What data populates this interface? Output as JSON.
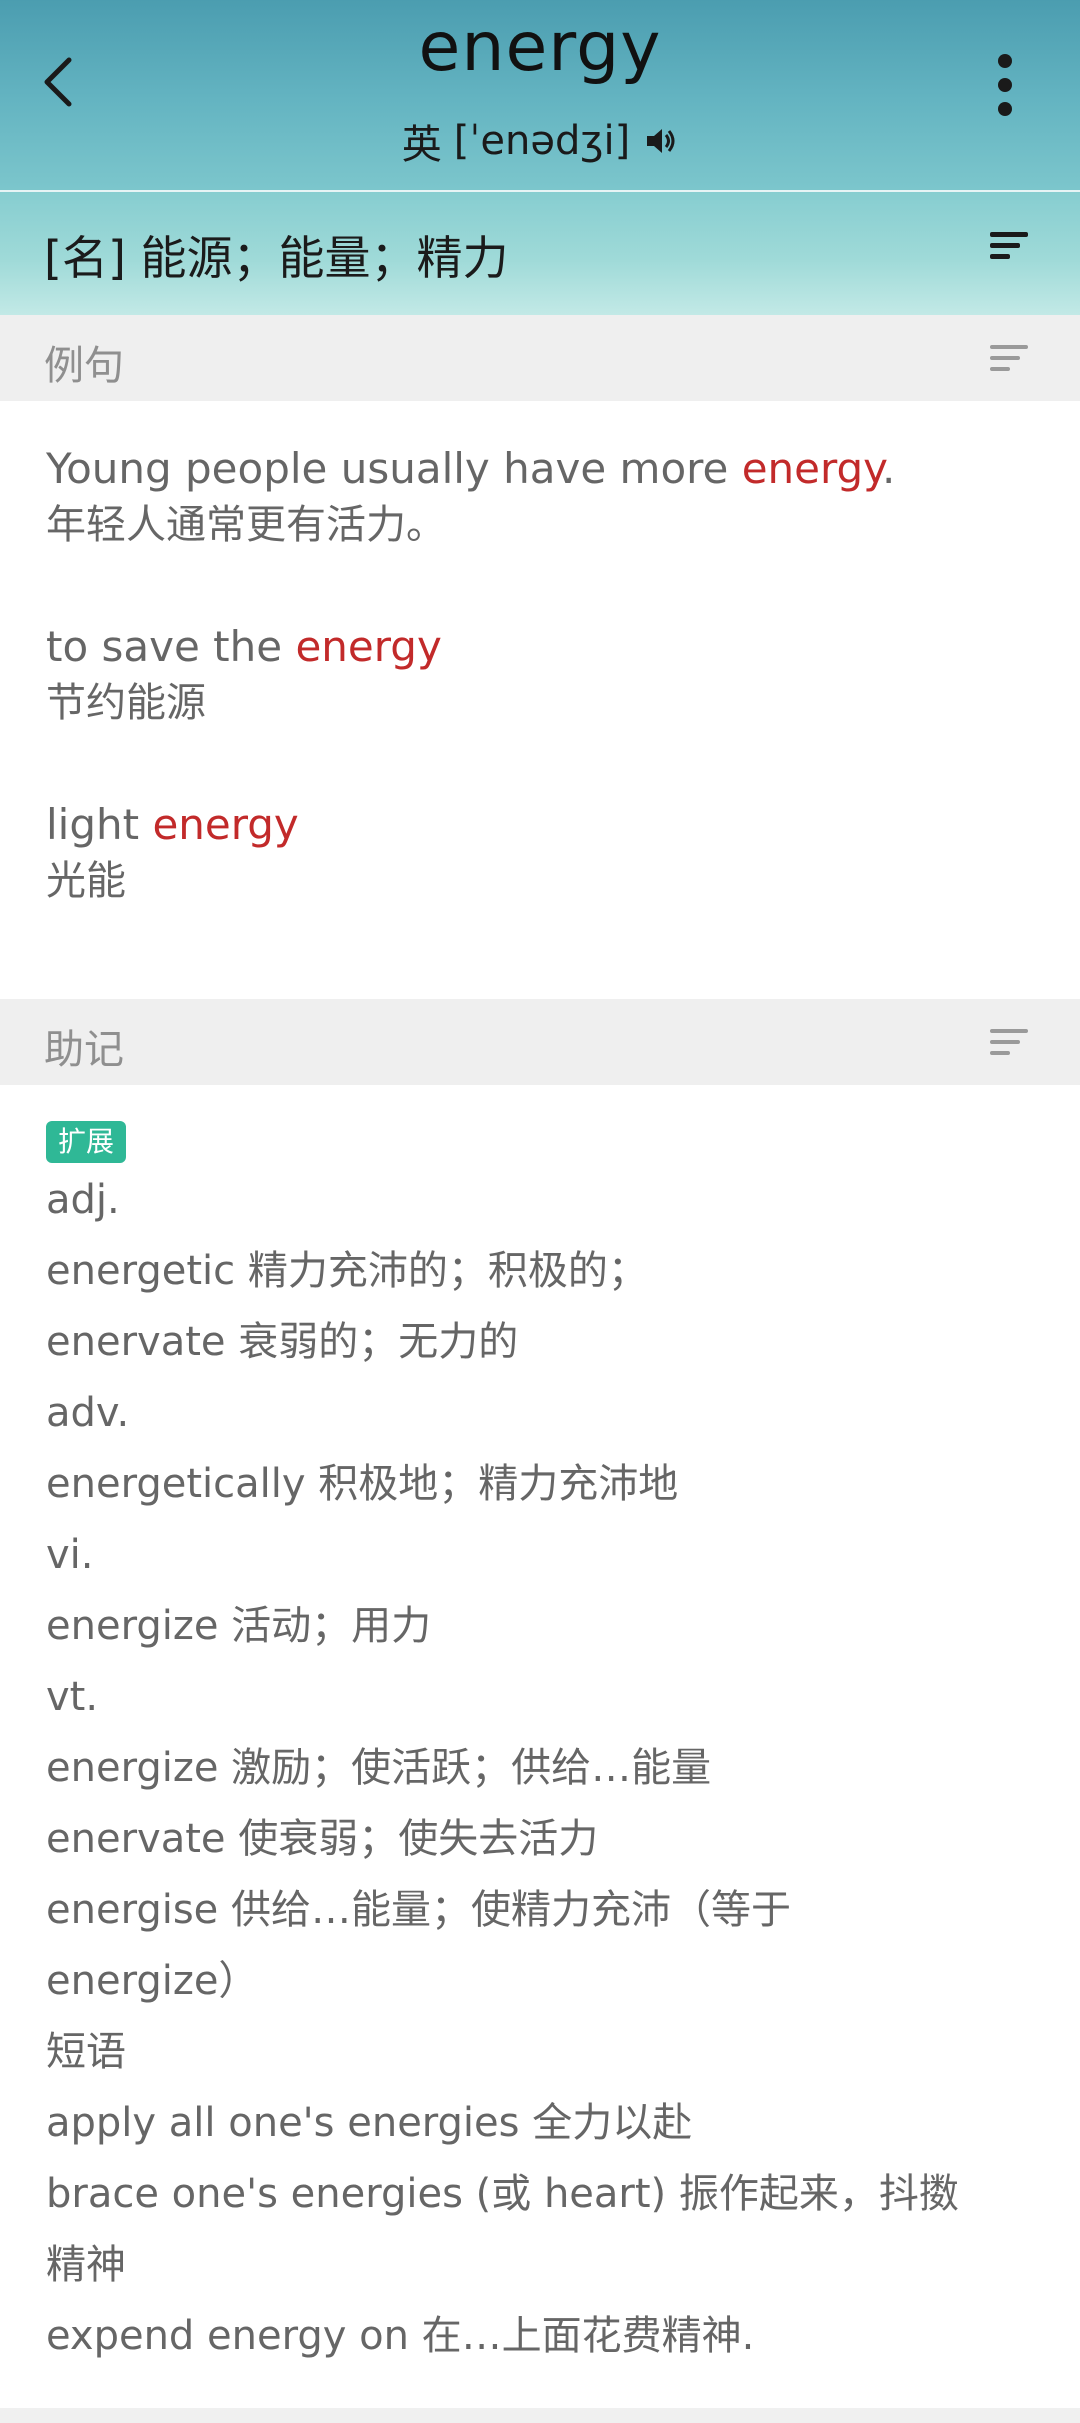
{
  "header": {
    "word": "energy",
    "region": "英",
    "ipa": "[ˈenədʒi]"
  },
  "meaning": "[名] 能源；能量；精力",
  "examples_section": {
    "title": "例句",
    "items": [
      {
        "pre": "Young people usually have more ",
        "hl": "energy",
        "post": ".",
        "zh": "年轻人通常更有活力。"
      },
      {
        "pre": "to save the ",
        "hl": "energy",
        "post": "",
        "zh": "节约能源"
      },
      {
        "pre": "light ",
        "hl": "energy",
        "post": "",
        "zh": "光能"
      }
    ]
  },
  "mnemonic_section": {
    "title": "助记",
    "tag": "扩展",
    "lines": [
      "adj.",
      "energetic 精力充沛的；积极的；",
      "enervate 衰弱的；无力的",
      "adv.",
      "energetically 积极地；精力充沛地",
      "vi.",
      "energize 活动；用力",
      "vt.",
      "energize 激励；使活跃；供给…能量",
      "enervate 使衰弱；使失去活力",
      "energise 供给…能量；使精力充沛（等于",
      "energize）",
      "短语",
      "apply all one's energies 全力以赴",
      "brace one's energies (或 heart) 振作起来，抖擞",
      "精神",
      "expend energy on 在…上面花费精神."
    ]
  },
  "colors": {
    "header_top": "#4b9db0",
    "highlight": "#c22a2a",
    "tag_bg": "#2fb896",
    "section_bg": "#efefef"
  },
  "icons": {
    "back": "chevron-left-icon",
    "more": "more-vertical-icon",
    "speaker": "speaker-icon",
    "sort": "sort-lines-icon"
  }
}
